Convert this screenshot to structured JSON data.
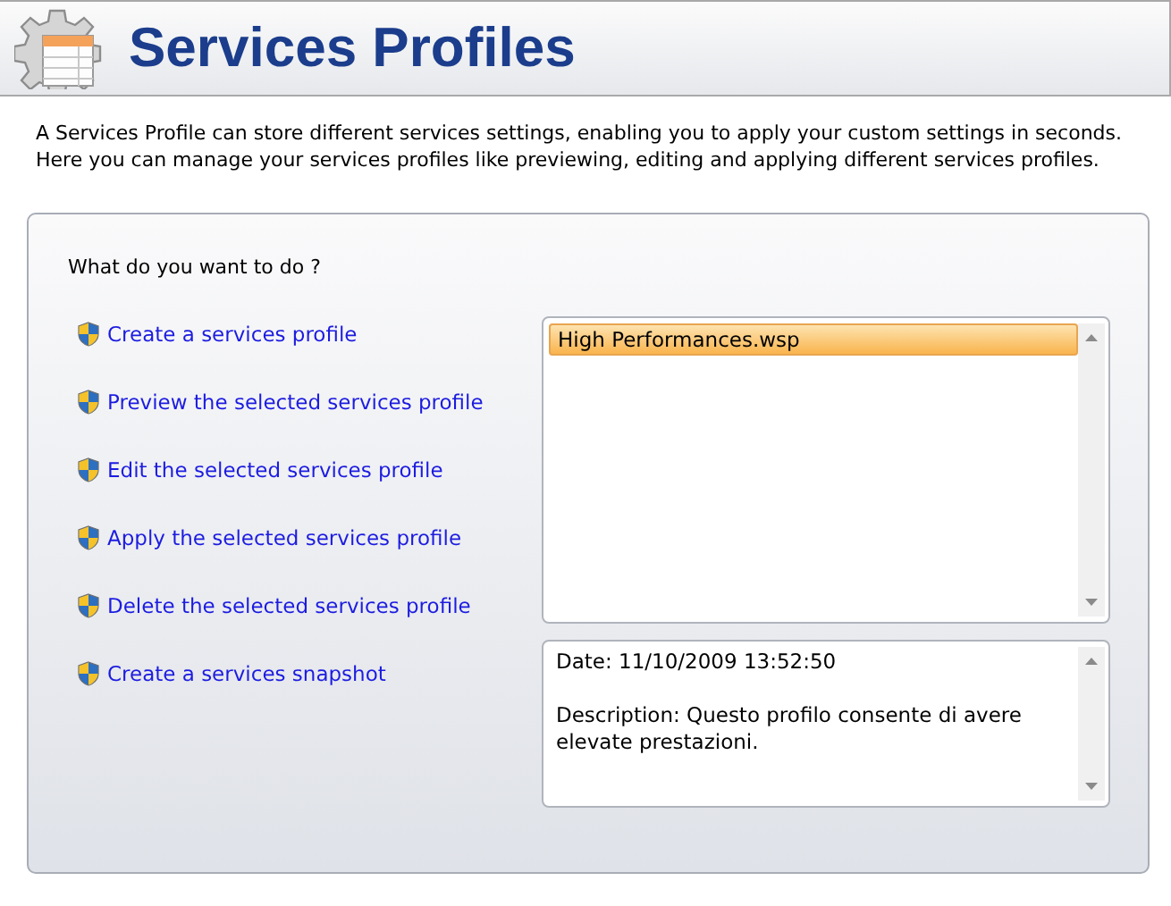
{
  "header": {
    "title": "Services Profiles"
  },
  "intro": [
    "A Services Profile can store different services settings, enabling you to apply your custom settings in seconds.",
    "Here you can manage your services profiles like previewing, editing and applying different services profiles."
  ],
  "panel": {
    "question": "What do you want to do ?",
    "actions": [
      "Create a services profile",
      "Preview the selected services profile",
      "Edit the selected services profile",
      "Apply the selected services profile",
      "Delete the selected services profile",
      "Create a services snapshot"
    ],
    "profiles": [
      {
        "name": "High Performances.wsp",
        "selected": true
      }
    ],
    "details": {
      "date": "Date: 11/10/2009 13:52:50",
      "description": "Description: Questo profilo consente di avere elevate prestazioni."
    }
  }
}
